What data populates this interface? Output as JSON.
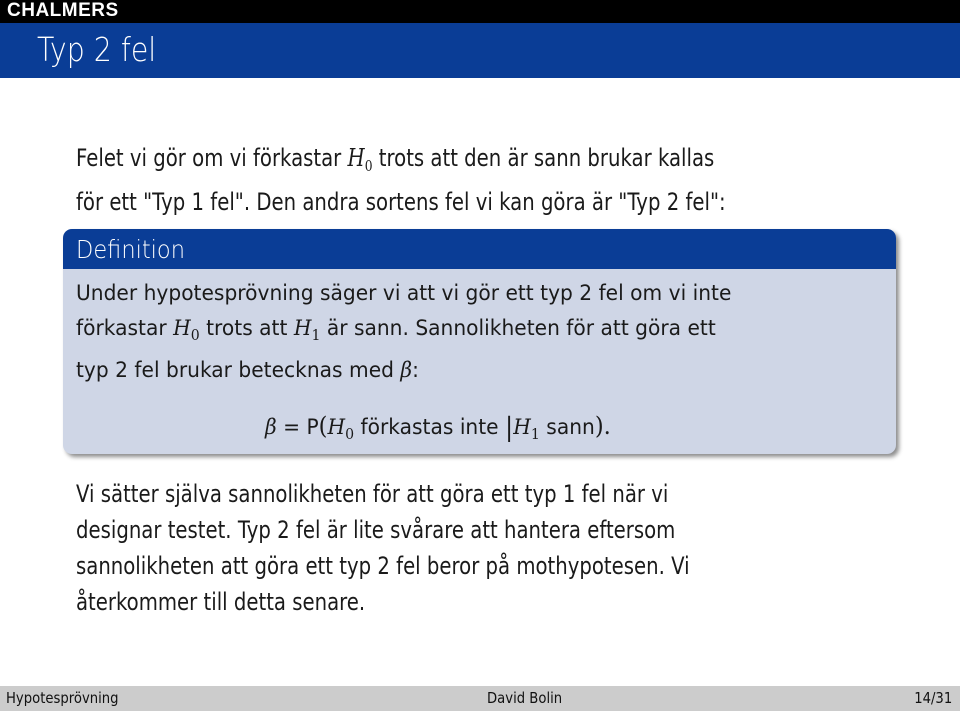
{
  "header": {
    "logo": "CHALMERS",
    "title": "Typ 2 fel"
  },
  "intro": {
    "line1_a": "Felet vi gör om vi förkastar ",
    "line1_math": "H",
    "line1_sub": "0",
    "line1_b": " trots att den är sann brukar kallas",
    "line2": "för ett \"Typ 1 fel\". Den andra sortens fel vi kan göra är \"Typ 2 fel\":"
  },
  "definition": {
    "heading": "Definition",
    "line1": "Under hypotesprövning säger vi att vi gör ett typ 2 fel om vi inte",
    "line2_a": "förkastar ",
    "line2_h0": "H",
    "line2_h0_sub": "0",
    "line2_b": " trots att ",
    "line2_h1": "H",
    "line2_h1_sub": "1",
    "line2_c": " är sann. Sannolikheten för att göra ett",
    "line3_a": "typ 2 fel brukar betecknas med ",
    "line3_beta": "β",
    "line3_b": ":",
    "formula": {
      "beta": "β",
      "eq": " = P",
      "open": "(",
      "h0": "H",
      "h0_sub": "0",
      "text": " förkastas inte ",
      "bar": "|",
      "h1": "H",
      "h1_sub": "1",
      "text2": " sann",
      "close": ").",
      "end": ""
    }
  },
  "outro": {
    "line1": "Vi sätter själva sannolikheten för att göra ett typ 1 fel när vi",
    "line2": "designar testet. Typ 2 fel är lite svårare att hantera eftersom",
    "line3": "sannolikheten att göra ett typ 2 fel beror på mothypotesen. Vi",
    "line4": "återkommer till detta senare."
  },
  "footer": {
    "section": "Hypotesprövning",
    "author": "David Bolin",
    "page": "14/31"
  }
}
